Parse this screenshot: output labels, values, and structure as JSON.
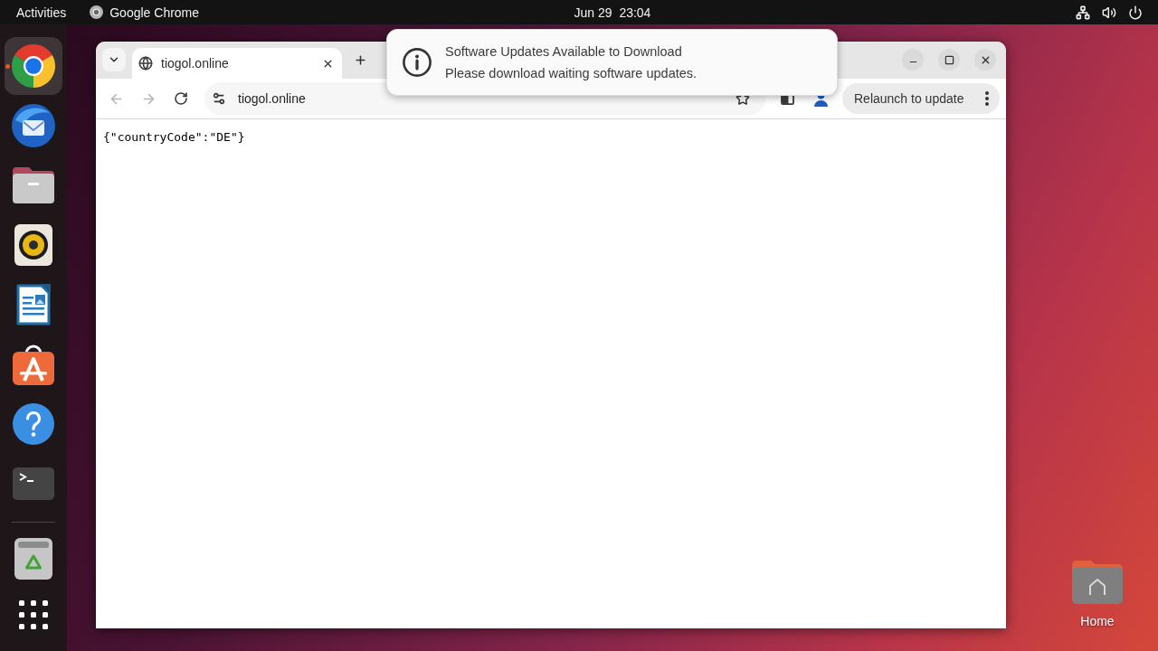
{
  "top_bar": {
    "activities": "Activities",
    "app_menu": "Google Chrome",
    "clock": "Jun 29  23:04"
  },
  "dock": {
    "apps": [
      {
        "kind": "browser",
        "selected": true,
        "running": true
      },
      {
        "kind": "mail",
        "selected": false,
        "running": false
      },
      {
        "kind": "files",
        "selected": false,
        "running": false
      },
      {
        "kind": "music",
        "selected": false,
        "running": false
      },
      {
        "kind": "writer",
        "selected": false,
        "running": false
      },
      {
        "kind": "software",
        "selected": false,
        "running": false
      },
      {
        "kind": "help",
        "selected": false,
        "running": false
      },
      {
        "kind": "terminal",
        "selected": false,
        "running": false
      }
    ],
    "system": [
      {
        "kind": "trash"
      },
      {
        "kind": "show_apps"
      }
    ]
  },
  "browser": {
    "tabs": [
      {
        "title": "tiogol.online",
        "selected": true
      }
    ],
    "back": {
      "disabled": true
    },
    "forward": {
      "disabled": true
    },
    "address": "tiogol.online",
    "relaunch_button": "Relaunch to update",
    "page_text": "{\"countryCode\":\"DE\"}"
  },
  "notification": {
    "title": "Software Updates Available to Download",
    "body": "Please download waiting software updates."
  },
  "desktop_icons": [
    {
      "label": "Home"
    }
  ]
}
